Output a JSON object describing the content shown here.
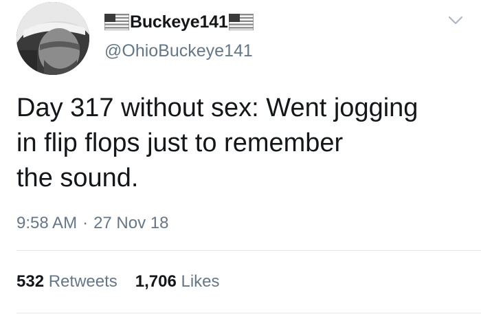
{
  "user": {
    "display_name": "Buckeye141",
    "handle": "@OhioBuckeye141",
    "flag_icon": "us-flag-icon"
  },
  "tweet": {
    "text": "Day 317 without sex: Went jogging\nin flip flops just to remember\nthe sound."
  },
  "timestamp": {
    "time": "9:58 AM",
    "separator": "·",
    "date": "27 Nov 18"
  },
  "stats": {
    "retweets_count": "532",
    "retweets_label": "Retweets",
    "likes_count": "1,706",
    "likes_label": "Likes"
  },
  "colors": {
    "text_primary": "#14171a",
    "text_secondary": "#657786",
    "divider": "#e1e8ed",
    "chevron": "#aab8c2"
  }
}
